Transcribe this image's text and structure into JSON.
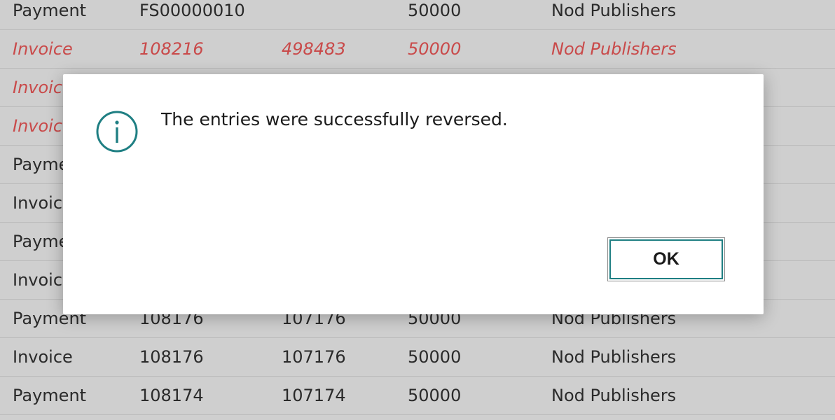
{
  "table": {
    "rows": [
      {
        "type": "Payment",
        "document_no": "FS00000010",
        "external_no": "",
        "vendor_no": "50000",
        "vendor_name": "Nod Publishers",
        "reversed": false
      },
      {
        "type": "Invoice",
        "document_no": "108216",
        "external_no": "498483",
        "vendor_no": "50000",
        "vendor_name": "Nod Publishers",
        "reversed": true
      },
      {
        "type": "Invoice",
        "document_no": "",
        "external_no": "",
        "vendor_no": "",
        "vendor_name": "",
        "reversed": true
      },
      {
        "type": "Invoice",
        "document_no": "",
        "external_no": "",
        "vendor_no": "",
        "vendor_name": "",
        "reversed": true
      },
      {
        "type": "Payment",
        "document_no": "",
        "external_no": "",
        "vendor_no": "",
        "vendor_name": "",
        "reversed": false
      },
      {
        "type": "Invoice",
        "document_no": "",
        "external_no": "",
        "vendor_no": "",
        "vendor_name": "",
        "reversed": false
      },
      {
        "type": "Payment",
        "document_no": "",
        "external_no": "",
        "vendor_no": "",
        "vendor_name": "",
        "reversed": false
      },
      {
        "type": "Invoice",
        "document_no": "",
        "external_no": "",
        "vendor_no": "",
        "vendor_name": "",
        "reversed": false
      },
      {
        "type": "Payment",
        "document_no": "108176",
        "external_no": "107176",
        "vendor_no": "50000",
        "vendor_name": "Nod Publishers",
        "reversed": false
      },
      {
        "type": "Invoice",
        "document_no": "108176",
        "external_no": "107176",
        "vendor_no": "50000",
        "vendor_name": "Nod Publishers",
        "reversed": false
      },
      {
        "type": "Payment",
        "document_no": "108174",
        "external_no": "107174",
        "vendor_no": "50000",
        "vendor_name": "Nod Publishers",
        "reversed": false
      }
    ]
  },
  "dialog": {
    "icon": "info-icon",
    "message": "The entries were successfully reversed.",
    "ok_label": "OK",
    "accent_color": "#1f7f83"
  }
}
